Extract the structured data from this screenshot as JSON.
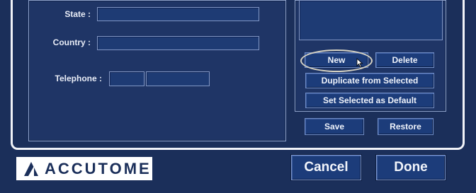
{
  "form": {
    "state_label": "State :",
    "country_label": "Country :",
    "telephone_label": "Telephone :"
  },
  "profile_buttons": {
    "new": "New",
    "delete": "Delete",
    "duplicate": "Duplicate from Selected",
    "set_default": "Set Selected as Default",
    "save": "Save",
    "restore": "Restore"
  },
  "footer": {
    "cancel": "Cancel",
    "done": "Done",
    "brand": "ACCUTOME"
  },
  "colors": {
    "background": "#1b2f5a",
    "button": "#1c3c7a",
    "highlight_ring": "#d8d4c4"
  }
}
